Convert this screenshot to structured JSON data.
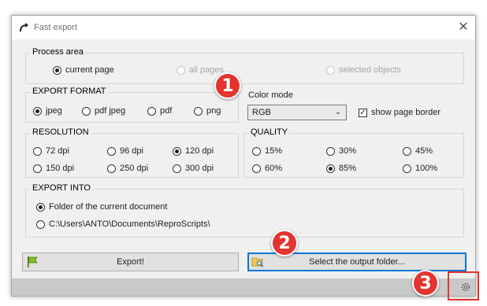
{
  "window": {
    "title": "Fast export",
    "close_glyph": "✕"
  },
  "process_area": {
    "legend": "Process area",
    "options": [
      {
        "label": "current page",
        "checked": true,
        "enabled": true
      },
      {
        "label": "all pages",
        "checked": false,
        "enabled": false
      },
      {
        "label": "selected objects",
        "checked": false,
        "enabled": false
      }
    ]
  },
  "export_format": {
    "legend": "EXPORT FORMAT",
    "options": [
      {
        "label": "jpeg",
        "checked": true
      },
      {
        "label": "pdf jpeg",
        "checked": false
      },
      {
        "label": "pdf",
        "checked": false
      },
      {
        "label": "png",
        "checked": false
      }
    ]
  },
  "color_mode": {
    "label": "Color mode",
    "value": "RGB"
  },
  "show_page_border": {
    "label": "show page border",
    "checked": true
  },
  "resolution": {
    "legend": "RESOLUTION",
    "options": [
      {
        "label": "72 dpi",
        "checked": false
      },
      {
        "label": "96 dpi",
        "checked": false
      },
      {
        "label": "120 dpi",
        "checked": true
      },
      {
        "label": "150 dpi",
        "checked": false
      },
      {
        "label": "250 dpi",
        "checked": false
      },
      {
        "label": "300 dpi",
        "checked": false
      }
    ]
  },
  "quality": {
    "legend": "QUALITY",
    "options": [
      {
        "label": "15%",
        "checked": false
      },
      {
        "label": "30%",
        "checked": false
      },
      {
        "label": "45%",
        "checked": false
      },
      {
        "label": "60%",
        "checked": false
      },
      {
        "label": "85%",
        "checked": true
      },
      {
        "label": "100%",
        "checked": false
      }
    ]
  },
  "export_into": {
    "legend": "EXPORT INTO",
    "options": [
      {
        "label": "Folder of the current document",
        "checked": true
      },
      {
        "label": "C:\\Users\\ANTO\\Documents\\ReproScripts\\",
        "checked": false
      }
    ]
  },
  "buttons": {
    "export": "Export!",
    "select_folder": "Select the output folder..."
  },
  "callouts": [
    "1",
    "2",
    "3"
  ],
  "icons": {
    "app": "export-arrow-icon",
    "export": "flag-icon",
    "folder": "folder-search-icon",
    "settings": "gear-icon"
  },
  "colors": {
    "callout": "#e3342f",
    "focus": "#0078d7"
  }
}
